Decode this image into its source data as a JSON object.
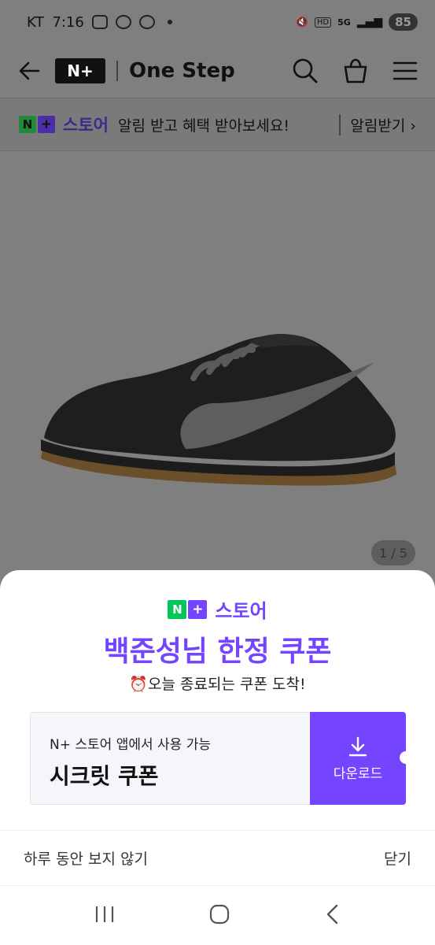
{
  "status_bar": {
    "carrier": "KT",
    "time": "7:16",
    "network": "5G",
    "battery": "85"
  },
  "header": {
    "logo_text": "N+",
    "store_name": "One Step"
  },
  "notify_bar": {
    "brand": "스토어",
    "message": "알림 받고 혜택 받아보세요!",
    "button": "알림받기"
  },
  "product": {
    "image_counter": {
      "current": "1",
      "separator": " / ",
      "total": "5"
    }
  },
  "coupon_sheet": {
    "brand": "스토어",
    "title": "백준성님 한정 쿠폰",
    "subtitle": "⏰오늘 종료되는 쿠폰 도착!",
    "coupon_caption": "N+ 스토어 앱에서 사용 가능",
    "coupon_name": "시크릿 쿠폰",
    "download_label": "다운로드",
    "hide_today": "하루 동안 보지 않기",
    "close": "닫기"
  },
  "colors": {
    "accent": "#7444ff",
    "naver_green": "#03c75a",
    "overlay_bg": "#7f7f7f"
  }
}
